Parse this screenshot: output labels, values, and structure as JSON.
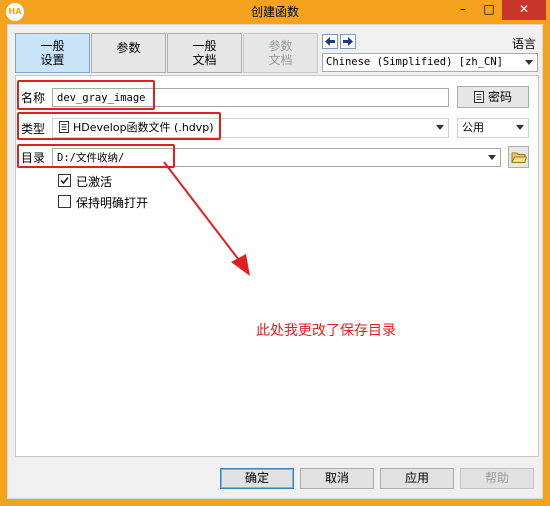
{
  "window": {
    "title": "创建函数",
    "app_icon_text": "HA",
    "minimize_glyph": "–",
    "maximize_glyph": "□",
    "close_glyph": "✕"
  },
  "toolbar": {
    "tabs": [
      {
        "line1": "一般",
        "line2": "设置",
        "state": "active"
      },
      {
        "line1": "参数",
        "line2": "",
        "state": "normal"
      },
      {
        "line1": "一般",
        "line2": "文档",
        "state": "normal"
      },
      {
        "line1": "参数",
        "line2": "文档",
        "state": "disabled"
      }
    ],
    "language_label": "语言",
    "language_value": "Chinese (Simplified) [zh_CN]"
  },
  "form": {
    "name_label": "名称",
    "name_value": "dev_gray_image",
    "password_button": "密码",
    "type_label": "类型",
    "type_value": "HDevelop函数文件 (.hdvp)",
    "scope_value": "公用",
    "dir_label": "目录",
    "dir_value": "D:/文件收纳/",
    "activated_label": "已激活",
    "activated_checked": true,
    "keep_open_label": "保持明确打开",
    "keep_open_checked": false
  },
  "annotation": {
    "text": "此处我更改了保存目录",
    "color": "#e02020"
  },
  "buttons": {
    "ok": "确定",
    "cancel": "取消",
    "apply": "应用",
    "help": "帮助"
  },
  "colors": {
    "titlebar": "#f5a31e",
    "close": "#c7352b",
    "highlight": "#e02020"
  },
  "icons": {
    "back": "arrow-left-icon",
    "forward": "arrow-right-icon",
    "folder": "folder-open-icon",
    "password": "document-lock-icon",
    "type_file": "file-icon"
  }
}
